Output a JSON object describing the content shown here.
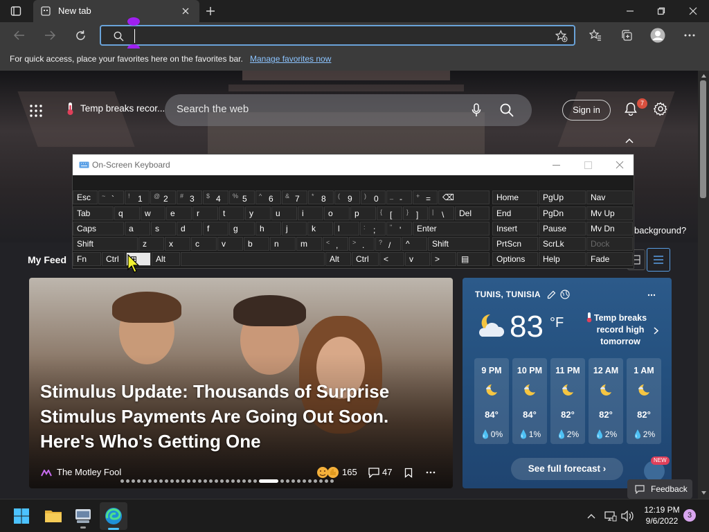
{
  "browser": {
    "tab_title": "New tab",
    "favorites_hint": "For quick access, place your favorites here on the favorites bar.",
    "favorites_link": "Manage favorites now",
    "address_value": ""
  },
  "newtab": {
    "trending": "Temp breaks recor...",
    "search_placeholder": "Search the web",
    "sign_in": "Sign in",
    "notification_count": "7",
    "my_feed": "My Feed",
    "background_question": "background?"
  },
  "news": {
    "headline": "Stimulus Update: Thousands of Surprise Stimulus Payments Are Going Out Soon. Here's Who's Getting One",
    "source": "The Motley Fool",
    "reactions": "165",
    "comments": "47"
  },
  "weather": {
    "location": "TUNIS, TUNISIA",
    "temperature": "83",
    "unit": "°F",
    "alert": "Temp breaks record high tomorrow",
    "hours": [
      {
        "time": "9 PM",
        "temp": "84°",
        "precip": "0%"
      },
      {
        "time": "10 PM",
        "temp": "84°",
        "precip": "1%"
      },
      {
        "time": "11 PM",
        "temp": "82°",
        "precip": "2%"
      },
      {
        "time": "12 AM",
        "temp": "82°",
        "precip": "2%"
      },
      {
        "time": "1 AM",
        "temp": "82°",
        "precip": "2%"
      }
    ],
    "forecast_button": "See full forecast",
    "new_badge": "NEW"
  },
  "feedback": "Feedback",
  "osk": {
    "title": "On-Screen Keyboard",
    "rows": [
      [
        [
          "Esc",
          ""
        ],
        [
          "`",
          "~"
        ],
        [
          "1",
          "!"
        ],
        [
          "2",
          "@"
        ],
        [
          "3",
          "#"
        ],
        [
          "4",
          "$"
        ],
        [
          "5",
          "%"
        ],
        [
          "6",
          "^"
        ],
        [
          "7",
          "&"
        ],
        [
          "8",
          "*"
        ],
        [
          "9",
          "("
        ],
        [
          "0",
          ")"
        ],
        [
          "-",
          "_"
        ],
        [
          "=",
          "+"
        ],
        [
          "⌫",
          ""
        ]
      ],
      [
        [
          "Tab",
          ""
        ],
        [
          "q",
          ""
        ],
        [
          "w",
          ""
        ],
        [
          "e",
          ""
        ],
        [
          "r",
          ""
        ],
        [
          "t",
          ""
        ],
        [
          "y",
          ""
        ],
        [
          "u",
          ""
        ],
        [
          "i",
          ""
        ],
        [
          "o",
          ""
        ],
        [
          "p",
          ""
        ],
        [
          "[",
          "{"
        ],
        [
          "]",
          "}"
        ],
        [
          "\\",
          "|"
        ],
        [
          "Del",
          ""
        ]
      ],
      [
        [
          "Caps",
          ""
        ],
        [
          "a",
          ""
        ],
        [
          "s",
          ""
        ],
        [
          "d",
          ""
        ],
        [
          "f",
          ""
        ],
        [
          "g",
          ""
        ],
        [
          "h",
          ""
        ],
        [
          "j",
          ""
        ],
        [
          "k",
          ""
        ],
        [
          "l",
          ""
        ],
        [
          ";",
          ":"
        ],
        [
          "'",
          "\""
        ],
        [
          "Enter",
          ""
        ]
      ],
      [
        [
          "Shift",
          ""
        ],
        [
          "z",
          ""
        ],
        [
          "x",
          ""
        ],
        [
          "c",
          ""
        ],
        [
          "v",
          ""
        ],
        [
          "b",
          ""
        ],
        [
          "n",
          ""
        ],
        [
          "m",
          ""
        ],
        [
          ",",
          "<"
        ],
        [
          ".",
          ">"
        ],
        [
          "/",
          "?"
        ],
        [
          "^",
          ""
        ],
        [
          "Shift",
          ""
        ]
      ],
      [
        [
          "Fn",
          ""
        ],
        [
          "Ctrl",
          ""
        ],
        [
          "⊞",
          ""
        ],
        [
          "Alt",
          ""
        ],
        [
          "",
          ""
        ],
        [
          "Alt",
          ""
        ],
        [
          "Ctrl",
          ""
        ],
        [
          "<",
          ""
        ],
        [
          "v",
          ""
        ],
        [
          ">",
          ""
        ],
        [
          "▤",
          ""
        ]
      ]
    ],
    "nav": [
      [
        "Home",
        "PgUp",
        "Nav"
      ],
      [
        "End",
        "PgDn",
        "Mv Up"
      ],
      [
        "Insert",
        "Pause",
        "Mv Dn"
      ],
      [
        "PrtScn",
        "ScrLk",
        "Dock"
      ],
      [
        "Options",
        "Help",
        "Fade"
      ]
    ]
  },
  "taskbar": {
    "time": "12:19 PM",
    "date": "9/6/2022",
    "notifications": "3"
  }
}
